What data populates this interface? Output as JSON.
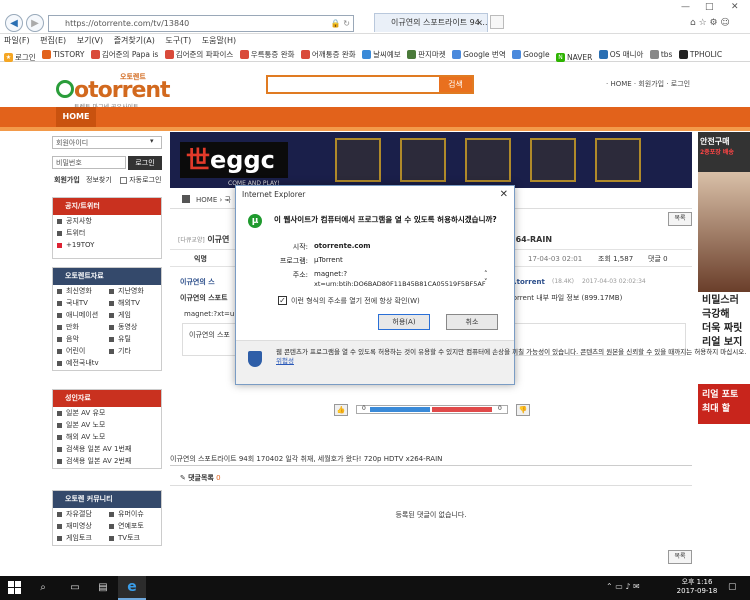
{
  "browser": {
    "url": "https://otorrente.com/tv/13840",
    "tab_title": "이규연의 스포트라이트 94...",
    "menu": [
      "파일(F)",
      "편집(E)",
      "보기(V)",
      "즐겨찾기(A)",
      "도구(T)",
      "도움말(H)"
    ],
    "favorites": [
      "로그인",
      "TISTORY",
      "김어준의 Papa is",
      "김어준의 파파이스",
      "우륵통증 완화",
      "어깨통증 완화",
      "날씨예보",
      "판지마켓",
      "Google 번역",
      "Google",
      "NAVER",
      "OS 매니아",
      "tbs",
      "TPHOLIC"
    ]
  },
  "site": {
    "logo_top": "오토렌트",
    "logo": "otorrent",
    "logo_sub": "토렌트 마그넷 공유사이트",
    "search_button": "검색",
    "top_links": "· HOME · 회원가입 · 로그인",
    "home_tab": "HOME"
  },
  "login": {
    "id_placeholder": "회원아이디",
    "pw_placeholder": "비밀번호",
    "login_button": "로그인",
    "signup": "회원가입",
    "find": "정보찾기",
    "auto": "자동로그인"
  },
  "boxes": {
    "notice": {
      "title": "공지/트위터",
      "items": [
        "공지사항",
        "트위터",
        "+19TOY"
      ]
    },
    "video": {
      "title": "오토렌트자료",
      "items": [
        [
          "최신영화",
          "지난영화"
        ],
        [
          "국내TV",
          "해외TV"
        ],
        [
          "애니메이션",
          "게임"
        ],
        [
          "만화",
          "동영상"
        ],
        [
          "음악",
          "유틸"
        ],
        [
          "어린이",
          "기타"
        ],
        [
          "예전국내tv",
          ""
        ]
      ]
    },
    "adult": {
      "title": "성인자료",
      "items": [
        "일본 AV 유모",
        "일본 AV 노모",
        "해외 AV 노모",
        "검색용 일본 AV 1번째",
        "검색용 일본 AV 2번째"
      ]
    },
    "community": {
      "title": "오토렌 커뮤니티",
      "items": [
        [
          "자유갤담",
          "유머이슈"
        ],
        [
          "재미영상",
          "연예포토"
        ],
        [
          "게임토크",
          "TV토크"
        ]
      ]
    }
  },
  "banner": {
    "logo_main": "eggc",
    "logo_sub": "COME AND PLAY!"
  },
  "post": {
    "breadcrumb": "HOME  ›  국",
    "list_button": "목록",
    "category": "[다큐교양]",
    "title_left": "이규연",
    "title_right": "264-RAIN",
    "author": "익명",
    "date": "17-04-03 02:01",
    "views_label": "조회",
    "views": "1,587",
    "comments_label": "댓글",
    "comments": "0",
    "file_left": "이규연의 스",
    "file_right": "v.torrent",
    "file_size": "(18.4K)",
    "file_date": "2017-04-03 02:02:34",
    "file_desc_left": "이규연의 스포트",
    "file_desc_right": "torrent 내부 파일 정보 (899.17MB)",
    "magnet": "magnet:?xt=u",
    "content_left": "이규연의 스포",
    "vote_up": "0",
    "vote_down": "0",
    "description": "이규연의 스포트라이트 94회 170402 일각 취재, 세월호가 왔다! 720p HDTV x264-RAIN",
    "comments_title": "댓글목록",
    "comments_count": "0",
    "no_comments": "등록된 댓글이 없습니다.",
    "list_button2": "목록"
  },
  "right_ad": {
    "top": "안전구매",
    "top2": "2중포장 배송",
    "text": "비밀스러\n극강해\n더욱 짜릿\n리얼 보지",
    "red": "리얼 포토\n최대 할"
  },
  "dialog": {
    "title": "Internet Explorer",
    "question": "이 웹사이트가 컴퓨터에서 프로그램을 열 수 있도록 허용하시겠습니까?",
    "from_label": "시작:",
    "from": "otorrente.com",
    "program_label": "프로그램:",
    "program": "µTorrent",
    "address_label": "주소:",
    "address1": "magnet:?",
    "address2": "xt=urn:btih:DO6BAD80F11B45B81CA05519F5BF5AF",
    "checkbox": "이런 형식의 주소를 열기 전에 항상 확인(W)",
    "allow": "허용(A)",
    "cancel": "취소",
    "footer": "웹 콘텐츠가 프로그램을 열 수 있도록 허용하는 것이 유용할 수 있지만 컴퓨터에 손상을 끼칠 가능성이 있습니다. 콘텐츠의 원본을 신뢰할 수 있을 때까지는 허용하지 마십시오.",
    "footer_link": "위험성"
  },
  "taskbar": {
    "time": "오후 1:16",
    "date": "2017-09-18"
  }
}
